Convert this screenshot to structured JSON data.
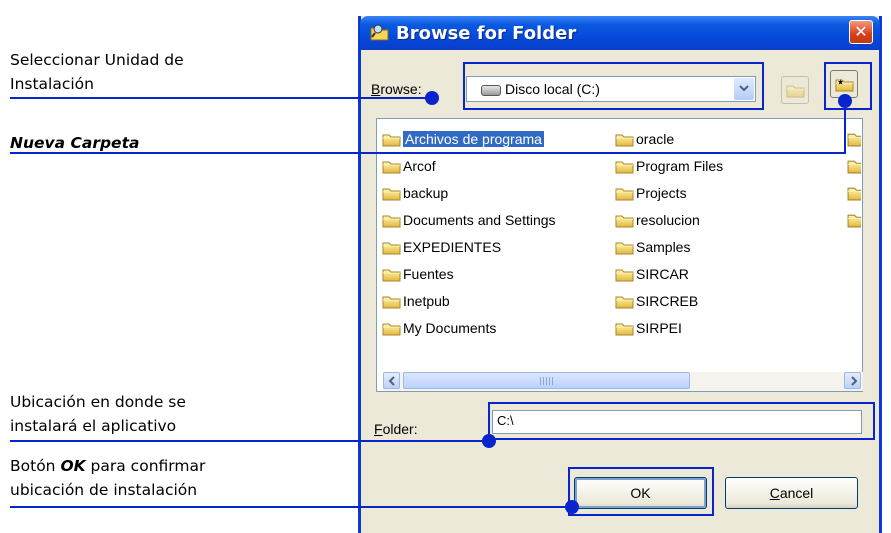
{
  "annotations": {
    "drive_line1": "Seleccionar Unidad de",
    "drive_line2": "Instalación",
    "new_folder": "Nueva Carpeta",
    "location_line1": "Ubicación en donde se",
    "location_line2": "instalará el aplicativo",
    "ok_prefix": "Botón ",
    "ok_word": "OK",
    "ok_suffix": " para confirmar",
    "ok_line2": "ubicación de instalación"
  },
  "dialog": {
    "title": "Browse for Folder",
    "close_glyph": "✕",
    "browse_label_key": "B",
    "browse_label_rest": "rowse:",
    "selected_drive": "Disco local (C:)",
    "folder_label_key": "F",
    "folder_label_rest": "older:",
    "folder_value": "C:\\",
    "ok_label": "OK",
    "cancel_key": "C",
    "cancel_rest": "ancel"
  },
  "folders_col1": [
    "Archivos de programa",
    "Arcof",
    "backup",
    "Documents and Settings",
    "EXPEDIENTES",
    "Fuentes",
    "Inetpub",
    "My Documents"
  ],
  "folders_col2": [
    "oracle",
    "Program Files",
    "Projects",
    "resolucion",
    "Samples",
    "SIRCAR",
    "SIRCREB",
    "SIRPEI"
  ],
  "selected_folder": "Archivos de programa",
  "icons": {
    "title": "folder-search-icon",
    "drive": "hard-drive-icon",
    "folder": "folder-icon",
    "up": "up-folder-icon",
    "new_folder": "new-folder-icon"
  },
  "colors": {
    "annotation": "#0a24cc",
    "selection": "#316ac5",
    "titlebar": "#0546d9"
  }
}
